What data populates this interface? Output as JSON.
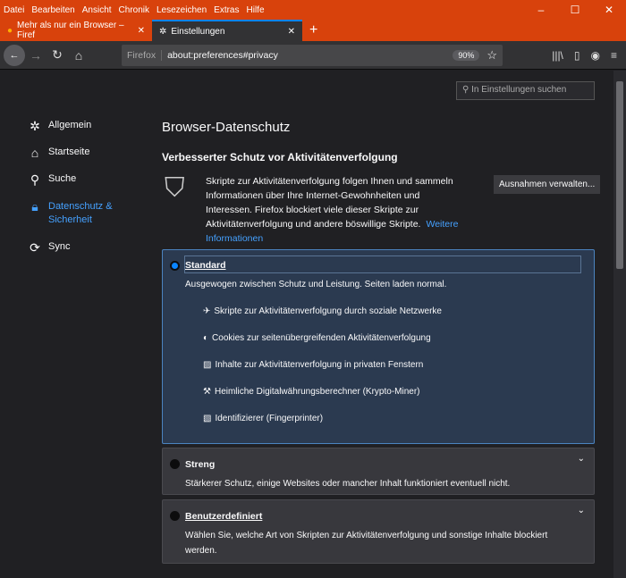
{
  "menu": [
    "Datei",
    "Bearbeiten",
    "Ansicht",
    "Chronik",
    "Lesezeichen",
    "Extras",
    "Hilfe"
  ],
  "tabs": [
    {
      "label": "Mehr als nur ein Browser – Firef"
    },
    {
      "label": "Einstellungen"
    }
  ],
  "url": {
    "identity": "Firefox",
    "value": "about:preferences#privacy",
    "zoom": "90%"
  },
  "search_placeholder": "In Einstellungen suchen",
  "sidebar": [
    {
      "label": "Allgemein"
    },
    {
      "label": "Startseite"
    },
    {
      "label": "Suche"
    },
    {
      "label": "Datenschutz & Sicherheit"
    },
    {
      "label": "Sync"
    }
  ],
  "page_title": "Browser-Datenschutz",
  "section_title": "Verbesserter Schutz vor Aktivitätenverfolgung",
  "description": "Skripte zur Aktivitätenverfolgung folgen Ihnen und sammeln Informationen über Ihre Internet-Gewohnheiten und Interessen. Firefox blockiert viele dieser Skripte zur Aktivitätenverfolgung und andere böswillige Skripte.",
  "more_info": "Weitere Informationen",
  "exceptions_button": "Ausnahmen verwalten...",
  "options": [
    {
      "title": "Standard",
      "desc": "Ausgewogen zwischen Schutz und Leistung. Seiten laden normal.",
      "selected": true,
      "features": [
        "Skripte zur Aktivitätenverfolgung durch soziale Netzwerke",
        "Cookies zur seitenübergreifenden Aktivitätenverfolgung",
        "Inhalte zur Aktivitätenverfolgung in privaten Fenstern",
        "Heimliche Digitalwährungsberechner (Krypto-Miner)",
        "Identifizierer (Fingerprinter)"
      ]
    },
    {
      "title": "Streng",
      "desc": "Stärkerer Schutz, einige Websites oder mancher Inhalt funktioniert eventuell nicht."
    },
    {
      "title": "Benutzerdefiniert",
      "desc": "Wählen Sie, welche Art von Skripten zur Aktivitätenverfolgung und sonstige Inhalte blockiert werden."
    }
  ]
}
